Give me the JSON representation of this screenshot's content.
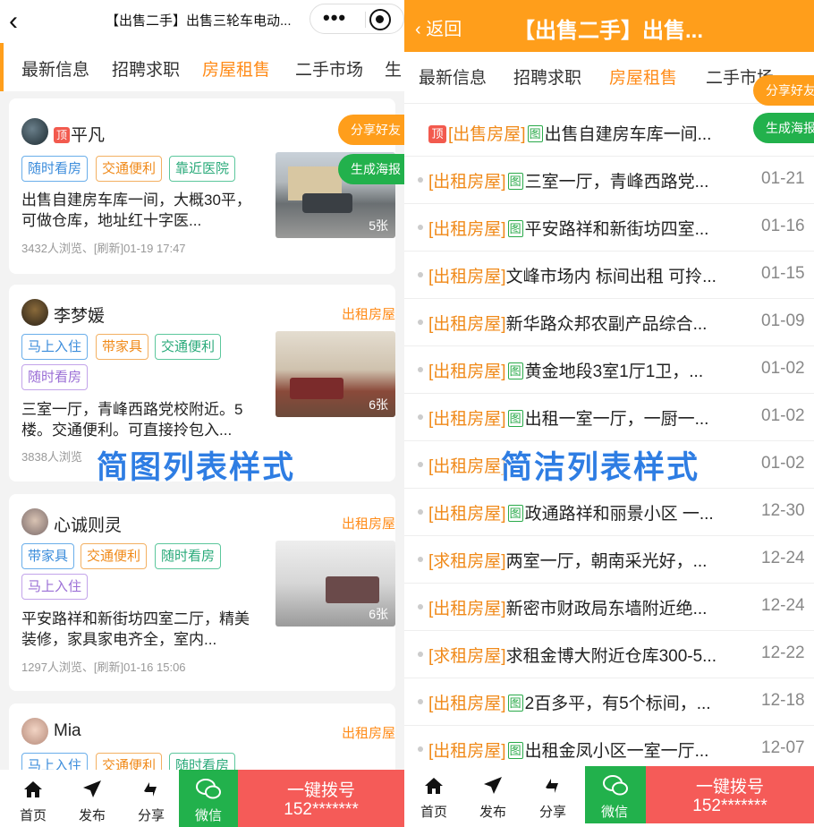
{
  "left": {
    "title": "【出售二手】出售三轮车电动...",
    "tabs": [
      "最新信息",
      "招聘求职",
      "房屋租售",
      "二手市场",
      "生"
    ],
    "active_tab": 2,
    "float_share": "分享好友",
    "float_poster": "生成海报",
    "style_label": "简图列表样式",
    "cards": [
      {
        "name": "平凡",
        "top": "顶",
        "category": "",
        "tags": [
          "随时看房",
          "交通便利",
          "靠近医院"
        ],
        "desc": "出售自建房车库一间，大概30平，可做仓库，地址红十字医...",
        "meta": "3432人浏览、[刷新]01-19 17:47",
        "photos": "5张"
      },
      {
        "name": "李梦媛",
        "category": "出租房屋",
        "tags": [
          "马上入住",
          "带家具",
          "交通便利",
          "随时看房"
        ],
        "desc": "三室一厅，青峰西路党校附近。5楼。交通便利。可直接拎包入...",
        "meta": "3838人浏览",
        "photos": "6张"
      },
      {
        "name": "心诚则灵",
        "category": "出租房屋",
        "tags": [
          "带家具",
          "交通便利",
          "随时看房",
          "马上入住"
        ],
        "desc": "平安路祥和新街坊四室二厅，精美装修，家具家电齐全，室内...",
        "meta": "1297人浏览、[刷新]01-16 15:06",
        "photos": "6张"
      },
      {
        "name": "Mia",
        "category": "出租房屋",
        "tags": [
          "马上入住",
          "交通便利",
          "随时看房"
        ]
      }
    ],
    "bottom": {
      "home": "首页",
      "post": "发布",
      "share": "分享",
      "wechat": "微信",
      "call": "一键拨号",
      "phone": "152*******"
    }
  },
  "right": {
    "back": "返回",
    "title": "【出售二手】出售...",
    "tabs": [
      "最新信息",
      "招聘求职",
      "房屋租售",
      "二手市场"
    ],
    "active_tab": 2,
    "float_share": "分享好友",
    "float_poster": "生成海报",
    "style_label": "简洁列表样式",
    "rows": [
      {
        "top": "顶",
        "category": "[出售房屋]",
        "img": "图",
        "title": "出售自建房车库一间...",
        "date": ""
      },
      {
        "category": "[出租房屋]",
        "img": "图",
        "title": "三室一厅，青峰西路党...",
        "date": "01-21"
      },
      {
        "category": "[出租房屋]",
        "img": "图",
        "title": "平安路祥和新街坊四室...",
        "date": "01-16"
      },
      {
        "category": "[出租房屋]",
        "img": "",
        "title": "文峰市场内 标间出租 可拎...",
        "date": "01-15"
      },
      {
        "category": "[出租房屋]",
        "img": "",
        "title": "新华路众邦农副产品综合...",
        "date": "01-09"
      },
      {
        "category": "[出租房屋]",
        "img": "图",
        "title": "黄金地段3室1厅1卫，...",
        "date": "01-02"
      },
      {
        "category": "[出租房屋]",
        "img": "图",
        "title": "出租一室一厅，一厨一...",
        "date": "01-02"
      },
      {
        "category": "[出租房屋]",
        "img": "",
        "title": "",
        "date": "01-02"
      },
      {
        "category": "[出租房屋]",
        "img": "图",
        "title": "政通路祥和丽景小区 一...",
        "date": "12-30"
      },
      {
        "category": "[求租房屋]",
        "img": "",
        "title": "两室一厅，朝南采光好，...",
        "date": "12-24"
      },
      {
        "category": "[出租房屋]",
        "img": "",
        "title": "新密市财政局东墙附近绝...",
        "date": "12-24"
      },
      {
        "category": "[求租房屋]",
        "img": "",
        "title": "求租金博大附近仓库300-5...",
        "date": "12-22"
      },
      {
        "category": "[出租房屋]",
        "img": "图",
        "title": "2百多平，有5个标间，...",
        "date": "12-18"
      },
      {
        "category": "[出租房屋]",
        "img": "图",
        "title": "出租金凤小区一室一厅...",
        "date": "12-07"
      }
    ],
    "bottom": {
      "home": "首页",
      "post": "发布",
      "share": "分享",
      "wechat": "微信",
      "call": "一键拨号",
      "phone": "152*******"
    }
  },
  "colors": {
    "accent": "#ff9e1b",
    "call": "#f55b58",
    "wechat": "#22b14c"
  }
}
